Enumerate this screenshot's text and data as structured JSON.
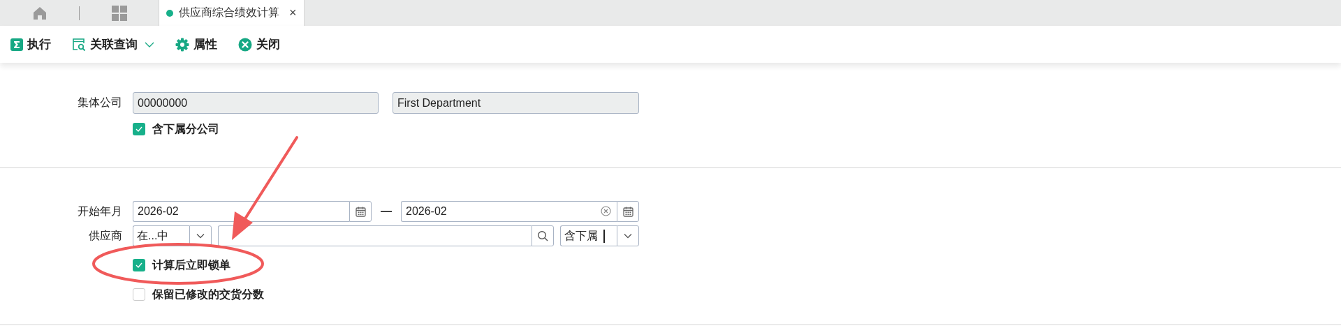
{
  "tabs": [
    {
      "kind": "home",
      "selected": false
    },
    {
      "kind": "grid",
      "selected": false
    },
    {
      "kind": "page",
      "label": "供应商综合绩效计算",
      "close": "×",
      "selected": true
    }
  ],
  "toolbar": [
    {
      "kind": "sigma",
      "label": "执行"
    },
    {
      "kind": "query",
      "label": "关联查询",
      "dropdown": true
    },
    {
      "kind": "gear",
      "label": "属性"
    },
    {
      "kind": "close",
      "label": "关闭"
    }
  ],
  "sections": [
    {
      "rows": [
        {
          "kind": "text-pair",
          "label": "集体公司",
          "value": "00000000",
          "value_2": "First Department"
        },
        {
          "kind": "checkbox",
          "label": "含下属分公司",
          "checked": true
        }
      ]
    },
    {
      "rows": [
        {
          "kind": "date-range",
          "label": "开始年月",
          "from": "2026-02",
          "separator": "—",
          "to": "2026-02",
          "to_clearable": true
        },
        {
          "kind": "supplier",
          "label": "供应商",
          "operator": "在...中",
          "scope": "含下属"
        },
        {
          "kind": "checkbox",
          "label": "计算后立即锁单",
          "checked": true
        },
        {
          "kind": "checkbox",
          "label": "保留已修改的交货分数",
          "checked": false
        }
      ]
    }
  ]
}
